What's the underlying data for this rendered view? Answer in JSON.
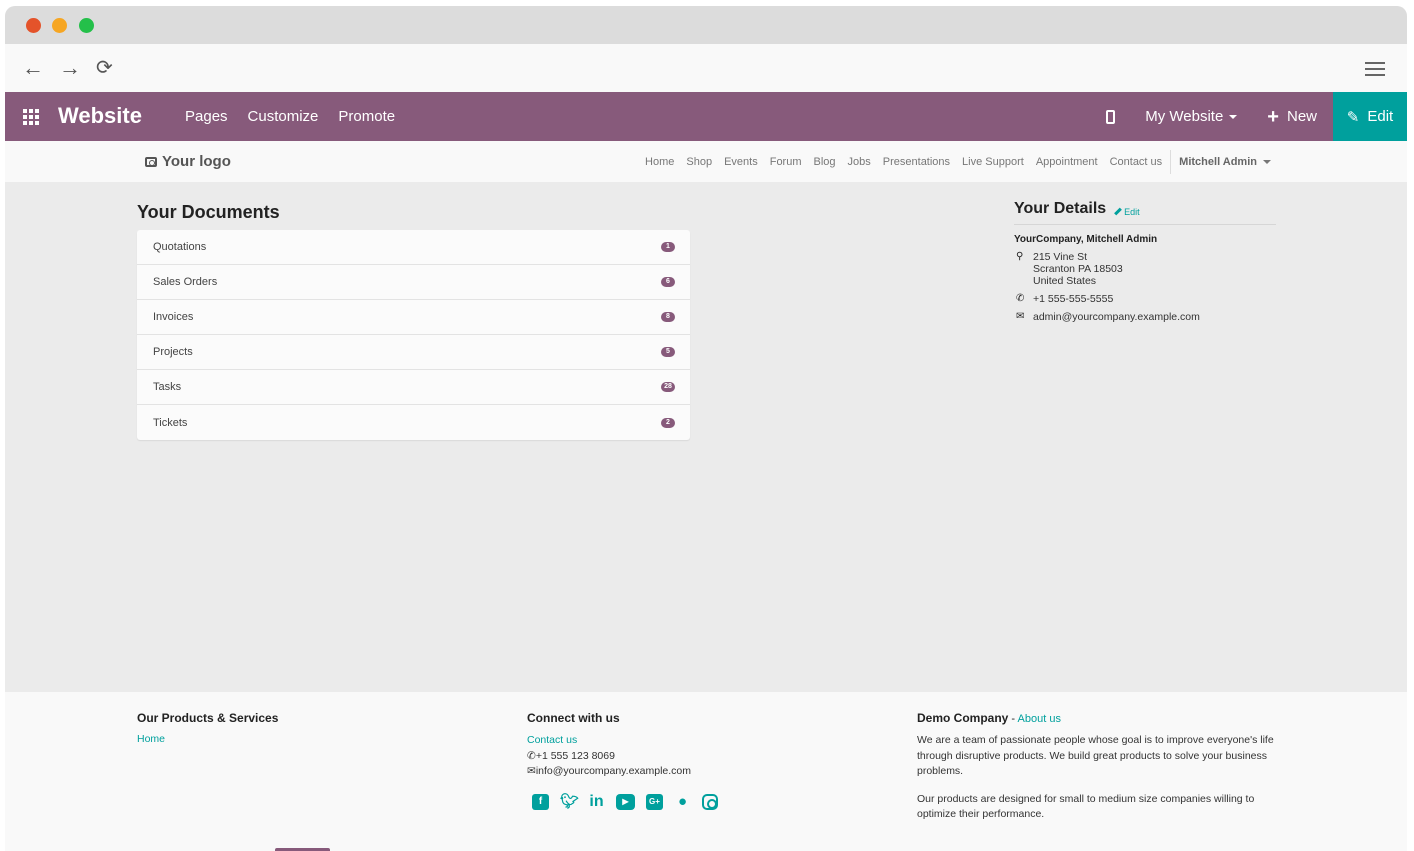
{
  "browser": {
    "back_icon": "←",
    "forward_icon": "→",
    "reload_icon": "⟳"
  },
  "odoo_bar": {
    "app_title": "Website",
    "menu": [
      "Pages",
      "Customize",
      "Promote"
    ],
    "my_website": "My Website",
    "new_label": "New",
    "edit_label": "Edit",
    "colors": {
      "bar": "#875a7b",
      "edit": "#00a09d"
    }
  },
  "site_header": {
    "logo_text": "Your logo",
    "nav": [
      "Home",
      "Shop",
      "Events",
      "Forum",
      "Blog",
      "Jobs",
      "Presentations",
      "Live Support",
      "Appointment",
      "Contact us"
    ],
    "user": "Mitchell Admin"
  },
  "documents": {
    "title": "Your Documents",
    "items": [
      {
        "label": "Quotations",
        "count": "1"
      },
      {
        "label": "Sales Orders",
        "count": "6"
      },
      {
        "label": "Invoices",
        "count": "8"
      },
      {
        "label": "Projects",
        "count": "5"
      },
      {
        "label": "Tasks",
        "count": "28"
      },
      {
        "label": "Tickets",
        "count": "2"
      }
    ]
  },
  "details": {
    "title": "Your Details",
    "edit_label": "Edit",
    "company": "YourCompany, Mitchell Admin",
    "address": [
      "215 Vine St",
      "Scranton PA 18503",
      "United States"
    ],
    "phone": "+1 555-555-5555",
    "email": "admin@yourcompany.example.com"
  },
  "footer": {
    "col1": {
      "title": "Our Products & Services",
      "link": "Home"
    },
    "col2": {
      "title": "Connect with us",
      "link": "Contact us",
      "phone": "+1 555 123 8069",
      "email": "info@yourcompany.example.com",
      "socials": [
        "facebook-icon",
        "twitter-icon",
        "linkedin-icon",
        "youtube-icon",
        "google-plus-icon",
        "github-icon",
        "instagram-icon"
      ]
    },
    "col3": {
      "title": "Demo Company",
      "separator": " - ",
      "link": "About us",
      "para1": "We are a team of passionate people whose goal is to improve everyone's life through disruptive products. We build great products to solve your business problems.",
      "para2": "Our products are designed for small to medium size companies willing to optimize their performance."
    }
  }
}
